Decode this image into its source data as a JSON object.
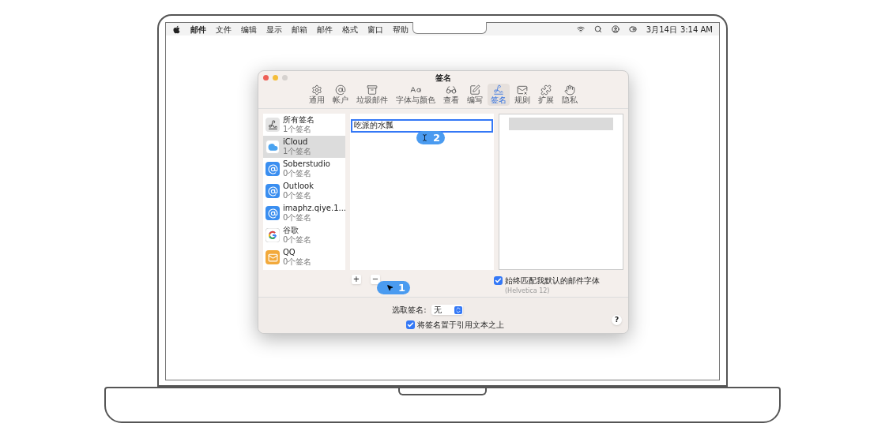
{
  "menu_bar": {
    "items": [
      {
        "label": "邮件",
        "bold": true
      },
      {
        "label": "文件",
        "bold": false
      },
      {
        "label": "编辑",
        "bold": false
      },
      {
        "label": "显示",
        "bold": false
      },
      {
        "label": "邮箱",
        "bold": false
      },
      {
        "label": "邮件",
        "bold": false
      },
      {
        "label": "格式",
        "bold": false
      },
      {
        "label": "窗口",
        "bold": false
      },
      {
        "label": "帮助",
        "bold": false
      }
    ],
    "date": "3月14日",
    "time": "3:14 AM"
  },
  "window": {
    "title": "签名",
    "tabs": [
      {
        "label": "通用",
        "selected": false
      },
      {
        "label": "帐户",
        "selected": false
      },
      {
        "label": "垃圾邮件",
        "selected": false
      },
      {
        "label": "字体与颜色",
        "selected": false
      },
      {
        "label": "查看",
        "selected": false
      },
      {
        "label": "编写",
        "selected": false
      },
      {
        "label": "签名",
        "selected": true
      },
      {
        "label": "规则",
        "selected": false
      },
      {
        "label": "扩展",
        "selected": false
      },
      {
        "label": "隐私",
        "selected": false
      }
    ],
    "accounts": [
      {
        "name": "所有签名",
        "count": "1个签名",
        "selected": false
      },
      {
        "name": "iCloud",
        "count": "1个签名",
        "selected": true
      },
      {
        "name": "Soberstudio",
        "count": "0个签名",
        "selected": false
      },
      {
        "name": "Outlook",
        "count": "0个签名",
        "selected": false
      },
      {
        "name": "imaphz.qiye.1...",
        "count": "0个签名",
        "selected": false
      },
      {
        "name": "谷歌",
        "count": "0个签名",
        "selected": false
      },
      {
        "name": "QQ",
        "count": "0个签名",
        "selected": false
      }
    ],
    "signature_name": {
      "value": "吃派的水瓢"
    },
    "add_button": "+",
    "remove_button": "−",
    "match_font": {
      "label": "始终匹配我默认的邮件字体",
      "checked": true,
      "note": "(Helvetica 12)"
    },
    "choose_signature": {
      "label": "选取签名:",
      "value": "无"
    },
    "place_above": {
      "label": "将签名置于引用文本之上",
      "checked": true
    },
    "help": "?"
  },
  "callouts": [
    "1",
    "2"
  ]
}
